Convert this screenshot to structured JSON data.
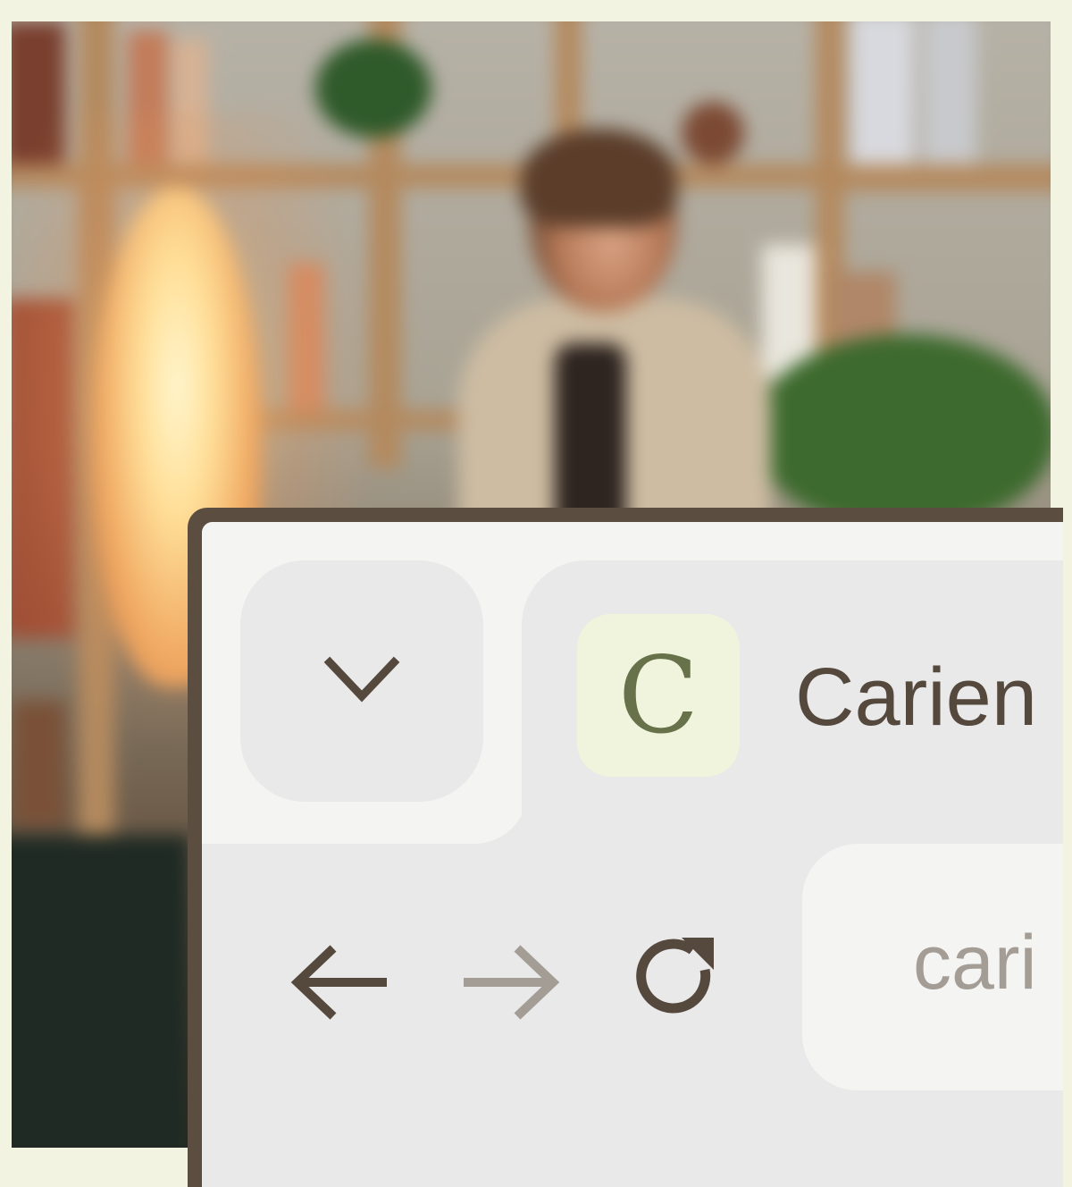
{
  "tab": {
    "title": "Carien",
    "favicon_letter": "C",
    "favicon_bg": "#f1f4dc",
    "favicon_color": "#67724b"
  },
  "toolbar": {
    "collapse_icon": "chevron-down-icon",
    "back_icon": "arrow-left-icon",
    "forward_icon": "arrow-right-icon",
    "reload_icon": "reload-icon"
  },
  "address_bar": {
    "value": "cari"
  },
  "colors": {
    "frame": "#5b4d40",
    "icon_active": "#55493e",
    "icon_disabled": "#a39d96"
  }
}
